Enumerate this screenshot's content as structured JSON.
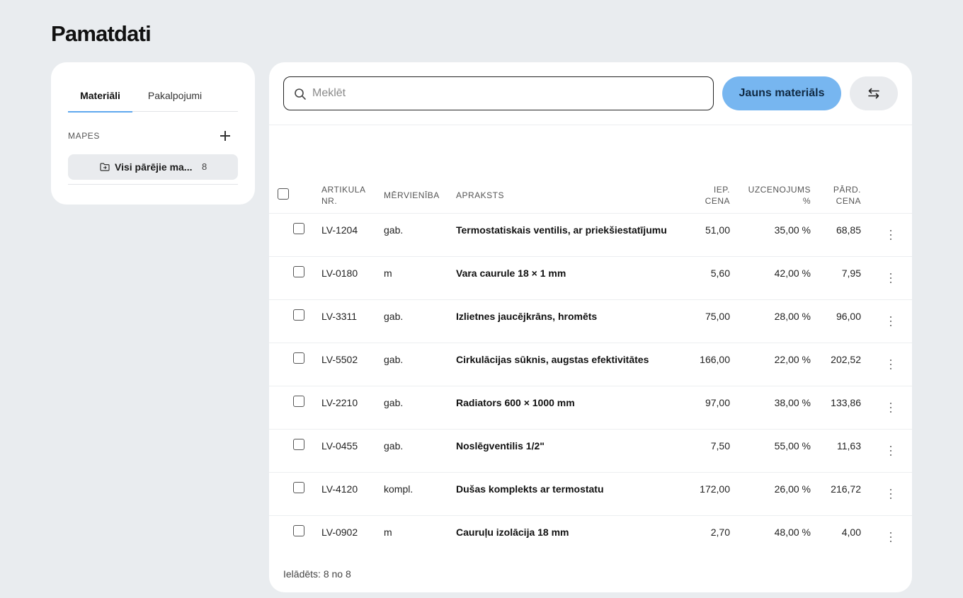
{
  "page": {
    "title": "Pamatdati"
  },
  "sidebar": {
    "tabs": [
      {
        "label": "Materiāli",
        "active": true
      },
      {
        "label": "Pakalpojumi",
        "active": false
      }
    ],
    "folders_label": "MAPES",
    "folders": [
      {
        "icon": "folder-icon",
        "name": "Visi pārējie ma...",
        "count": "8"
      }
    ]
  },
  "toolbar": {
    "search_placeholder": "Meklēt",
    "new_button_label": "Jauns materiāls",
    "accent_color": "#77b6f0"
  },
  "table": {
    "columns": {
      "article": [
        "ARTIKULA",
        "NR."
      ],
      "unit": "MĒRVIENĪBA",
      "description": "APRAKSTS",
      "purchase_price": [
        "IEP.",
        "CENA"
      ],
      "markup": [
        "UZCENOJUMS",
        "%"
      ],
      "sale_price": [
        "PĀRD.",
        "CENA"
      ]
    },
    "rows": [
      {
        "article": "LV-1204",
        "unit": "gab.",
        "description": "Termostatiskais ventilis, ar priekšiestatījumu",
        "purchase_price": "51,00",
        "markup": "35,00 %",
        "sale_price": "68,85"
      },
      {
        "article": "LV-0180",
        "unit": "m",
        "description": "Vara caurule 18 × 1 mm",
        "purchase_price": "5,60",
        "markup": "42,00 %",
        "sale_price": "7,95"
      },
      {
        "article": "LV-3311",
        "unit": "gab.",
        "description": "Izlietnes jaucējkrāns, hromēts",
        "purchase_price": "75,00",
        "markup": "28,00 %",
        "sale_price": "96,00"
      },
      {
        "article": "LV-5502",
        "unit": "gab.",
        "description": "Cirkulācijas sūknis, augstas efektivitātes",
        "purchase_price": "166,00",
        "markup": "22,00 %",
        "sale_price": "202,52"
      },
      {
        "article": "LV-2210",
        "unit": "gab.",
        "description": "Radiators 600 × 1000 mm",
        "purchase_price": "97,00",
        "markup": "38,00 %",
        "sale_price": "133,86"
      },
      {
        "article": "LV-0455",
        "unit": "gab.",
        "description": "Noslēgventilis 1/2\"",
        "purchase_price": "7,50",
        "markup": "55,00 %",
        "sale_price": "11,63"
      },
      {
        "article": "LV-4120",
        "unit": "kompl.",
        "description": "Dušas komplekts ar termostatu",
        "purchase_price": "172,00",
        "markup": "26,00 %",
        "sale_price": "216,72"
      },
      {
        "article": "LV-0902",
        "unit": "m",
        "description": "Cauruļu izolācija 18 mm",
        "purchase_price": "2,70",
        "markup": "48,00 %",
        "sale_price": "4,00"
      }
    ]
  },
  "footer": {
    "loaded_text": "Ielādēts: 8 no 8"
  }
}
